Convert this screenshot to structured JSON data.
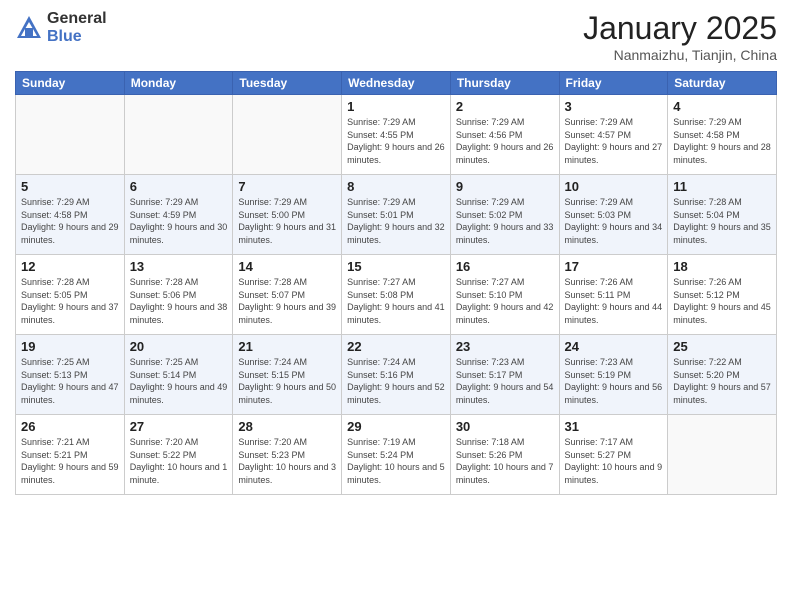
{
  "logo": {
    "general": "General",
    "blue": "Blue"
  },
  "header": {
    "title": "January 2025",
    "subtitle": "Nanmaizhu, Tianjin, China"
  },
  "weekdays": [
    "Sunday",
    "Monday",
    "Tuesday",
    "Wednesday",
    "Thursday",
    "Friday",
    "Saturday"
  ],
  "weeks": [
    [
      {
        "day": "",
        "sunrise": "",
        "sunset": "",
        "daylight": ""
      },
      {
        "day": "",
        "sunrise": "",
        "sunset": "",
        "daylight": ""
      },
      {
        "day": "",
        "sunrise": "",
        "sunset": "",
        "daylight": ""
      },
      {
        "day": "1",
        "sunrise": "Sunrise: 7:29 AM",
        "sunset": "Sunset: 4:55 PM",
        "daylight": "Daylight: 9 hours and 26 minutes."
      },
      {
        "day": "2",
        "sunrise": "Sunrise: 7:29 AM",
        "sunset": "Sunset: 4:56 PM",
        "daylight": "Daylight: 9 hours and 26 minutes."
      },
      {
        "day": "3",
        "sunrise": "Sunrise: 7:29 AM",
        "sunset": "Sunset: 4:57 PM",
        "daylight": "Daylight: 9 hours and 27 minutes."
      },
      {
        "day": "4",
        "sunrise": "Sunrise: 7:29 AM",
        "sunset": "Sunset: 4:58 PM",
        "daylight": "Daylight: 9 hours and 28 minutes."
      }
    ],
    [
      {
        "day": "5",
        "sunrise": "Sunrise: 7:29 AM",
        "sunset": "Sunset: 4:58 PM",
        "daylight": "Daylight: 9 hours and 29 minutes."
      },
      {
        "day": "6",
        "sunrise": "Sunrise: 7:29 AM",
        "sunset": "Sunset: 4:59 PM",
        "daylight": "Daylight: 9 hours and 30 minutes."
      },
      {
        "day": "7",
        "sunrise": "Sunrise: 7:29 AM",
        "sunset": "Sunset: 5:00 PM",
        "daylight": "Daylight: 9 hours and 31 minutes."
      },
      {
        "day": "8",
        "sunrise": "Sunrise: 7:29 AM",
        "sunset": "Sunset: 5:01 PM",
        "daylight": "Daylight: 9 hours and 32 minutes."
      },
      {
        "day": "9",
        "sunrise": "Sunrise: 7:29 AM",
        "sunset": "Sunset: 5:02 PM",
        "daylight": "Daylight: 9 hours and 33 minutes."
      },
      {
        "day": "10",
        "sunrise": "Sunrise: 7:29 AM",
        "sunset": "Sunset: 5:03 PM",
        "daylight": "Daylight: 9 hours and 34 minutes."
      },
      {
        "day": "11",
        "sunrise": "Sunrise: 7:28 AM",
        "sunset": "Sunset: 5:04 PM",
        "daylight": "Daylight: 9 hours and 35 minutes."
      }
    ],
    [
      {
        "day": "12",
        "sunrise": "Sunrise: 7:28 AM",
        "sunset": "Sunset: 5:05 PM",
        "daylight": "Daylight: 9 hours and 37 minutes."
      },
      {
        "day": "13",
        "sunrise": "Sunrise: 7:28 AM",
        "sunset": "Sunset: 5:06 PM",
        "daylight": "Daylight: 9 hours and 38 minutes."
      },
      {
        "day": "14",
        "sunrise": "Sunrise: 7:28 AM",
        "sunset": "Sunset: 5:07 PM",
        "daylight": "Daylight: 9 hours and 39 minutes."
      },
      {
        "day": "15",
        "sunrise": "Sunrise: 7:27 AM",
        "sunset": "Sunset: 5:08 PM",
        "daylight": "Daylight: 9 hours and 41 minutes."
      },
      {
        "day": "16",
        "sunrise": "Sunrise: 7:27 AM",
        "sunset": "Sunset: 5:10 PM",
        "daylight": "Daylight: 9 hours and 42 minutes."
      },
      {
        "day": "17",
        "sunrise": "Sunrise: 7:26 AM",
        "sunset": "Sunset: 5:11 PM",
        "daylight": "Daylight: 9 hours and 44 minutes."
      },
      {
        "day": "18",
        "sunrise": "Sunrise: 7:26 AM",
        "sunset": "Sunset: 5:12 PM",
        "daylight": "Daylight: 9 hours and 45 minutes."
      }
    ],
    [
      {
        "day": "19",
        "sunrise": "Sunrise: 7:25 AM",
        "sunset": "Sunset: 5:13 PM",
        "daylight": "Daylight: 9 hours and 47 minutes."
      },
      {
        "day": "20",
        "sunrise": "Sunrise: 7:25 AM",
        "sunset": "Sunset: 5:14 PM",
        "daylight": "Daylight: 9 hours and 49 minutes."
      },
      {
        "day": "21",
        "sunrise": "Sunrise: 7:24 AM",
        "sunset": "Sunset: 5:15 PM",
        "daylight": "Daylight: 9 hours and 50 minutes."
      },
      {
        "day": "22",
        "sunrise": "Sunrise: 7:24 AM",
        "sunset": "Sunset: 5:16 PM",
        "daylight": "Daylight: 9 hours and 52 minutes."
      },
      {
        "day": "23",
        "sunrise": "Sunrise: 7:23 AM",
        "sunset": "Sunset: 5:17 PM",
        "daylight": "Daylight: 9 hours and 54 minutes."
      },
      {
        "day": "24",
        "sunrise": "Sunrise: 7:23 AM",
        "sunset": "Sunset: 5:19 PM",
        "daylight": "Daylight: 9 hours and 56 minutes."
      },
      {
        "day": "25",
        "sunrise": "Sunrise: 7:22 AM",
        "sunset": "Sunset: 5:20 PM",
        "daylight": "Daylight: 9 hours and 57 minutes."
      }
    ],
    [
      {
        "day": "26",
        "sunrise": "Sunrise: 7:21 AM",
        "sunset": "Sunset: 5:21 PM",
        "daylight": "Daylight: 9 hours and 59 minutes."
      },
      {
        "day": "27",
        "sunrise": "Sunrise: 7:20 AM",
        "sunset": "Sunset: 5:22 PM",
        "daylight": "Daylight: 10 hours and 1 minute."
      },
      {
        "day": "28",
        "sunrise": "Sunrise: 7:20 AM",
        "sunset": "Sunset: 5:23 PM",
        "daylight": "Daylight: 10 hours and 3 minutes."
      },
      {
        "day": "29",
        "sunrise": "Sunrise: 7:19 AM",
        "sunset": "Sunset: 5:24 PM",
        "daylight": "Daylight: 10 hours and 5 minutes."
      },
      {
        "day": "30",
        "sunrise": "Sunrise: 7:18 AM",
        "sunset": "Sunset: 5:26 PM",
        "daylight": "Daylight: 10 hours and 7 minutes."
      },
      {
        "day": "31",
        "sunrise": "Sunrise: 7:17 AM",
        "sunset": "Sunset: 5:27 PM",
        "daylight": "Daylight: 10 hours and 9 minutes."
      },
      {
        "day": "",
        "sunrise": "",
        "sunset": "",
        "daylight": ""
      }
    ]
  ]
}
